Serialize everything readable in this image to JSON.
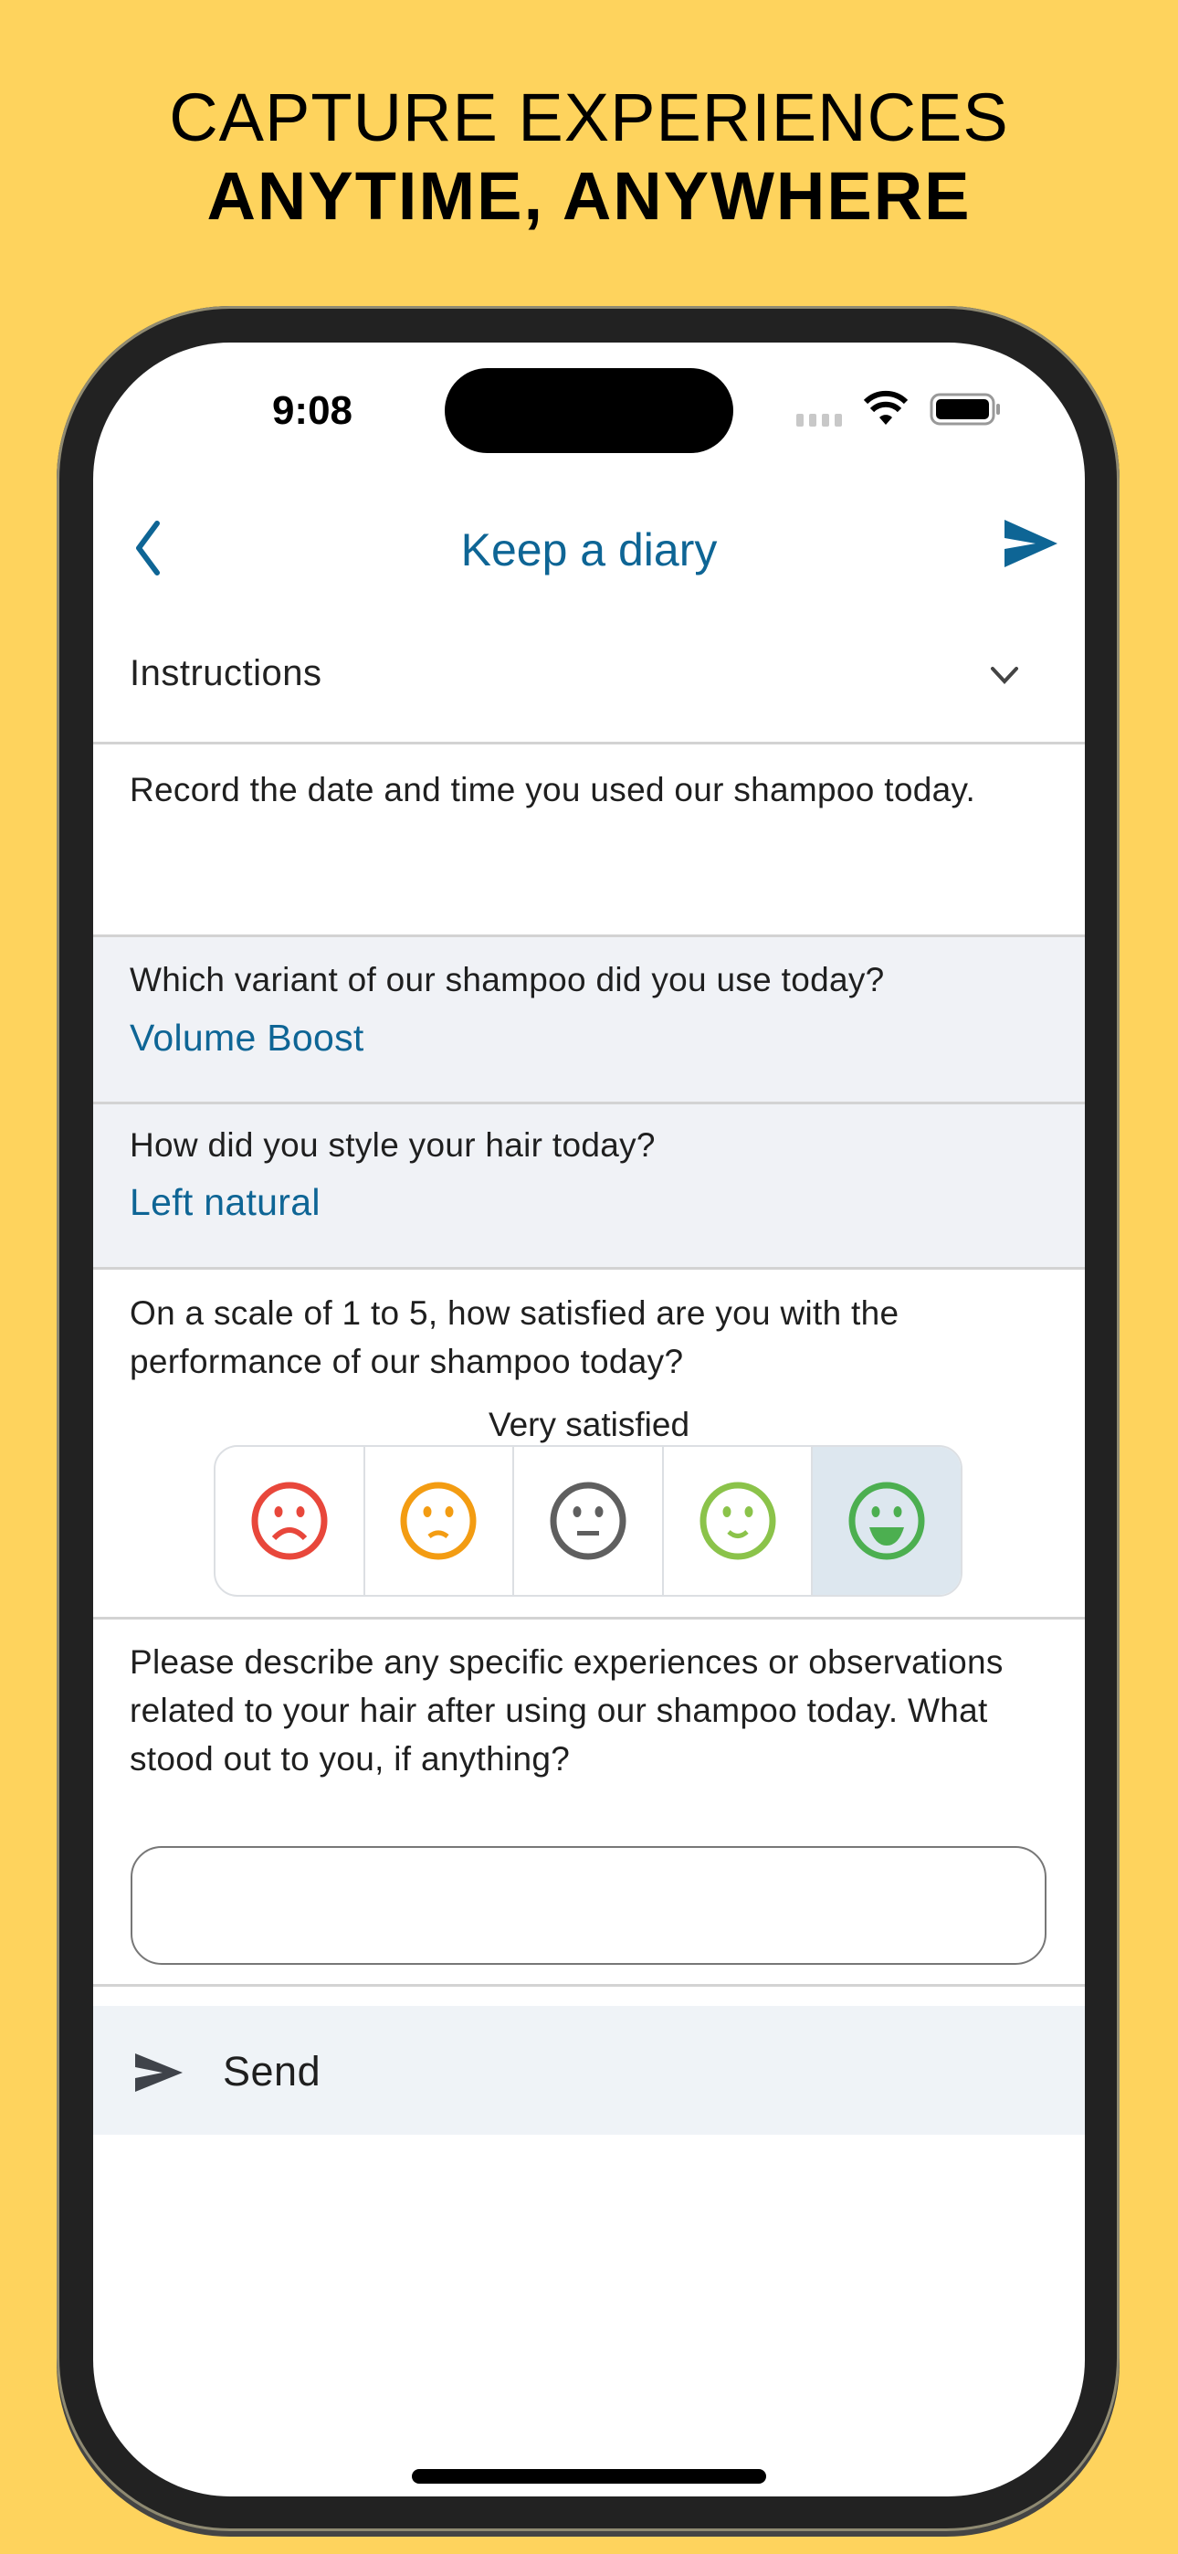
{
  "promo": {
    "line1": "CAPTURE EXPERIENCES",
    "line2": "ANYTIME, ANYWHERE"
  },
  "status_bar": {
    "time": "9:08",
    "icons": [
      "signal-icon",
      "wifi-icon",
      "battery-icon"
    ]
  },
  "nav": {
    "back_icon": "chevron-left-icon",
    "title": "Keep a diary",
    "send_icon": "send-icon"
  },
  "instructions": {
    "label": "Instructions",
    "expand_icon": "chevron-down-icon",
    "text": "Record the date and time you used our shampoo today."
  },
  "questions": [
    {
      "prompt": "Which variant of our shampoo did you use today?",
      "answer": "Volume Boost"
    },
    {
      "prompt": "How did you style your hair today?",
      "answer": "Left natural"
    }
  ],
  "rating": {
    "prompt": "On a scale of 1 to 5, how satisfied are you with the performance of our shampoo today?",
    "selected_label": "Very satisfied",
    "selected_value": 5,
    "scale_max": 5,
    "options": [
      {
        "value": 1,
        "icon": "very-sad-face-icon",
        "color": "#E8473B"
      },
      {
        "value": 2,
        "icon": "sad-face-icon",
        "color": "#F39C12"
      },
      {
        "value": 3,
        "icon": "neutral-face-icon",
        "color": "#5F5F5F"
      },
      {
        "value": 4,
        "icon": "smile-face-icon",
        "color": "#8BC34A"
      },
      {
        "value": 5,
        "icon": "happy-face-icon",
        "color": "#4CAF50"
      }
    ]
  },
  "open_question": {
    "prompt": "Please describe any specific experiences or observations related to your hair after using our shampoo today. What stood out to you, if anything?",
    "value": "",
    "placeholder": ""
  },
  "send_button": {
    "label": "Send",
    "icon": "send-icon"
  },
  "colors": {
    "background": "#FED35D",
    "accent": "#0E6595",
    "answer_block": "#F0F2F6",
    "selected_rating": "#DDE7EF"
  }
}
